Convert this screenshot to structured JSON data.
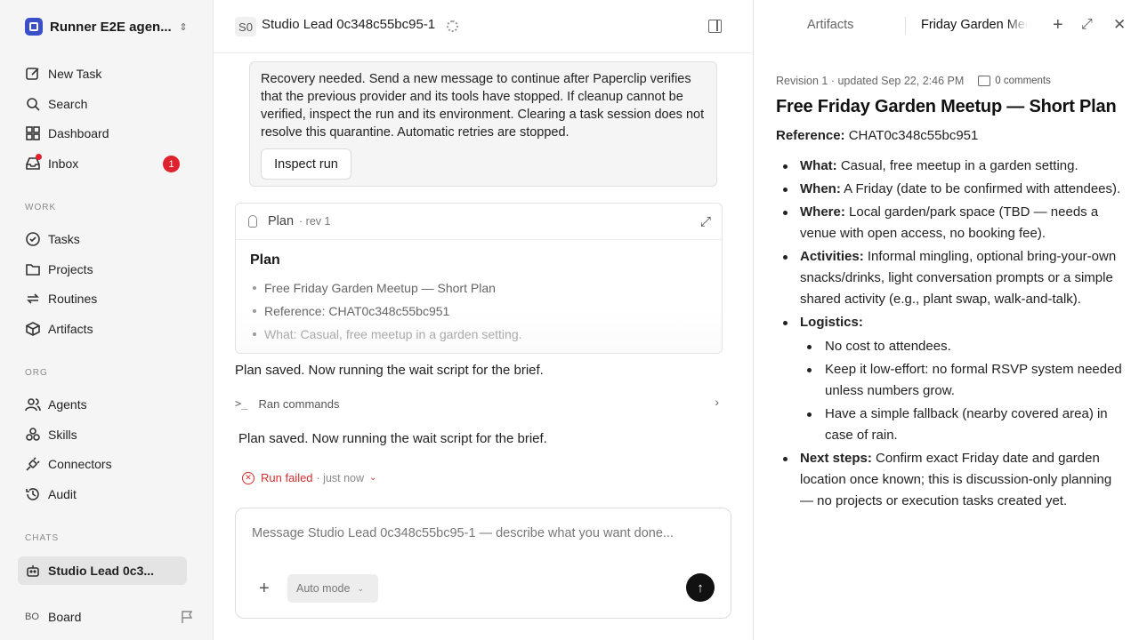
{
  "workspace": {
    "name": "Runner E2E agen..."
  },
  "nav": {
    "new_task": "New Task",
    "search": "Search",
    "dashboard": "Dashboard",
    "inbox": "Inbox",
    "inbox_badge": "1"
  },
  "sections": {
    "work": "WORK",
    "org": "ORG",
    "chats": "CHATS"
  },
  "work": {
    "tasks": "Tasks",
    "projects": "Projects",
    "routines": "Routines",
    "artifacts": "Artifacts"
  },
  "org": {
    "agents": "Agents",
    "skills": "Skills",
    "connectors": "Connectors",
    "audit": "Audit"
  },
  "chats": {
    "active": "Studio Lead 0c3..."
  },
  "board": {
    "initials": "BO",
    "label": "Board"
  },
  "header": {
    "avatar": "S0",
    "title": "Studio Lead 0c348c55bc95-1"
  },
  "recovery": {
    "text": "Recovery needed. Send a new message to continue after Paperclip verifies that the previous provider and its tools have stopped. If cleanup cannot be verified, inspect the run and its environment. Clearing a task session does not resolve this quarantine. Automatic retries are stopped.",
    "button": "Inspect run"
  },
  "plan_card": {
    "title": "Plan",
    "rev": "· rev 1",
    "heading": "Plan",
    "items": [
      "Free Friday Garden Meetup — Short Plan",
      "Reference: CHAT0c348c55bc951",
      "What: Casual, free meetup in a garden setting."
    ]
  },
  "messages": {
    "first": "Plan saved. Now running the wait script for the brief.",
    "ran_commands": "Ran commands",
    "second": "Plan saved. Now running the wait script for the brief."
  },
  "run_status": {
    "label": "Run failed",
    "time": "· just now"
  },
  "composer": {
    "placeholder": "Message Studio Lead 0c348c55bc95-1 — describe what you want done...",
    "mode": "Auto mode"
  },
  "right_panel": {
    "tab_artifacts": "Artifacts",
    "tab_active": "Friday Garden Meetup"
  },
  "document": {
    "revision": "Revision 1 · updated Sep 22, 2:46 PM",
    "comments": "0 comments",
    "title": "Free Friday Garden Meetup — Short Plan",
    "reference_label": "Reference:",
    "reference_value": "CHAT0c348c55bc951",
    "what_label": "What:",
    "what_text": "Casual, free meetup in a garden setting.",
    "when_label": "When:",
    "when_text": "A Friday (date to be confirmed with attendees).",
    "where_label": "Where:",
    "where_text": "Local garden/park space (TBD — needs a venue with open access, no booking fee).",
    "activities_label": "Activities:",
    "activities_text": "Informal mingling, optional bring-your-own snacks/drinks, light conversation prompts or a simple shared activity (e.g., plant swap, walk-and-talk).",
    "logistics_label": "Logistics:",
    "logistics_items": [
      "No cost to attendees.",
      "Keep it low-effort: no formal RSVP system needed unless numbers grow.",
      "Have a simple fallback (nearby covered area) in case of rain."
    ],
    "next_label": "Next steps:",
    "next_text": "Confirm exact Friday date and garden location once known; this is discussion-only planning — no projects or execution tasks created yet."
  }
}
